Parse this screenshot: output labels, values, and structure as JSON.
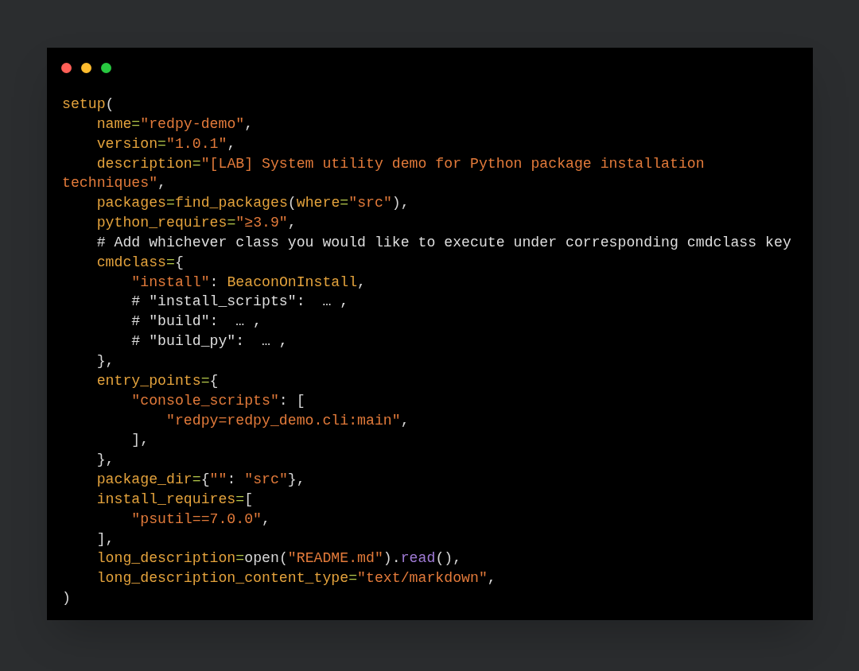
{
  "code_lines": [
    [
      {
        "kind": "ident",
        "text": "setup"
      },
      {
        "kind": "punct",
        "text": "("
      }
    ],
    [
      {
        "kind": "ident",
        "text": "    name"
      },
      {
        "kind": "op",
        "text": "="
      },
      {
        "kind": "str",
        "text": "\"redpy-demo\""
      },
      {
        "kind": "punct",
        "text": ","
      }
    ],
    [
      {
        "kind": "ident",
        "text": "    version"
      },
      {
        "kind": "op",
        "text": "="
      },
      {
        "kind": "str",
        "text": "\"1.0.1\""
      },
      {
        "kind": "punct",
        "text": ","
      }
    ],
    [
      {
        "kind": "ident",
        "text": "    description"
      },
      {
        "kind": "op",
        "text": "="
      },
      {
        "kind": "str",
        "text": "\"[LAB] System utility demo for Python package installation"
      }
    ],
    [
      {
        "kind": "str",
        "text": "techniques\""
      },
      {
        "kind": "punct",
        "text": ","
      }
    ],
    [
      {
        "kind": "ident",
        "text": "    packages"
      },
      {
        "kind": "op",
        "text": "="
      },
      {
        "kind": "ident",
        "text": "find_packages"
      },
      {
        "kind": "punct",
        "text": "("
      },
      {
        "kind": "ident",
        "text": "where"
      },
      {
        "kind": "op",
        "text": "="
      },
      {
        "kind": "str",
        "text": "\"src\""
      },
      {
        "kind": "punct",
        "text": "),"
      }
    ],
    [
      {
        "kind": "ident",
        "text": "    python_requires"
      },
      {
        "kind": "op",
        "text": "="
      },
      {
        "kind": "str",
        "text": "\"≥3.9\""
      },
      {
        "kind": "punct",
        "text": ","
      }
    ],
    [
      {
        "kind": "comment",
        "text": "    # Add whichever class you would like to execute under corresponding cmdclass key"
      }
    ],
    [
      {
        "kind": "ident",
        "text": "    cmdclass"
      },
      {
        "kind": "op",
        "text": "="
      },
      {
        "kind": "punct",
        "text": "{"
      }
    ],
    [
      {
        "kind": "str",
        "text": "        \"install\""
      },
      {
        "kind": "punct",
        "text": ": "
      },
      {
        "kind": "ident",
        "text": "BeaconOnInstall"
      },
      {
        "kind": "punct",
        "text": ","
      }
    ],
    [
      {
        "kind": "comment",
        "text": "        # \"install_scripts\":  … ,"
      }
    ],
    [
      {
        "kind": "comment",
        "text": "        # \"build\":  … ,"
      }
    ],
    [
      {
        "kind": "comment",
        "text": "        # \"build_py\":  … ,"
      }
    ],
    [
      {
        "kind": "punct",
        "text": "    },"
      }
    ],
    [
      {
        "kind": "ident",
        "text": "    entry_points"
      },
      {
        "kind": "op",
        "text": "="
      },
      {
        "kind": "punct",
        "text": "{"
      }
    ],
    [
      {
        "kind": "str",
        "text": "        \"console_scripts\""
      },
      {
        "kind": "punct",
        "text": ": ["
      }
    ],
    [
      {
        "kind": "str",
        "text": "            \"redpy=redpy_demo.cli:main\""
      },
      {
        "kind": "punct",
        "text": ","
      }
    ],
    [
      {
        "kind": "punct",
        "text": "        ],"
      }
    ],
    [
      {
        "kind": "punct",
        "text": "    },"
      }
    ],
    [
      {
        "kind": "ident",
        "text": "    package_dir"
      },
      {
        "kind": "op",
        "text": "="
      },
      {
        "kind": "punct",
        "text": "{"
      },
      {
        "kind": "str",
        "text": "\"\""
      },
      {
        "kind": "punct",
        "text": ": "
      },
      {
        "kind": "str",
        "text": "\"src\""
      },
      {
        "kind": "punct",
        "text": "},"
      }
    ],
    [
      {
        "kind": "ident",
        "text": "    install_requires"
      },
      {
        "kind": "op",
        "text": "="
      },
      {
        "kind": "punct",
        "text": "["
      }
    ],
    [
      {
        "kind": "str",
        "text": "        \"psutil==7.0.0\""
      },
      {
        "kind": "punct",
        "text": ","
      }
    ],
    [
      {
        "kind": "punct",
        "text": "    ],"
      }
    ],
    [
      {
        "kind": "ident",
        "text": "    long_description"
      },
      {
        "kind": "op",
        "text": "="
      },
      {
        "kind": "punct",
        "text": "open("
      },
      {
        "kind": "str",
        "text": "\"README.md\""
      },
      {
        "kind": "punct",
        "text": ")."
      },
      {
        "kind": "method",
        "text": "read"
      },
      {
        "kind": "punct",
        "text": "(),"
      }
    ],
    [
      {
        "kind": "ident",
        "text": "    long_description_content_type"
      },
      {
        "kind": "op",
        "text": "="
      },
      {
        "kind": "str",
        "text": "\"text/markdown\""
      },
      {
        "kind": "punct",
        "text": ","
      }
    ],
    [
      {
        "kind": "punct",
        "text": ")"
      }
    ]
  ]
}
